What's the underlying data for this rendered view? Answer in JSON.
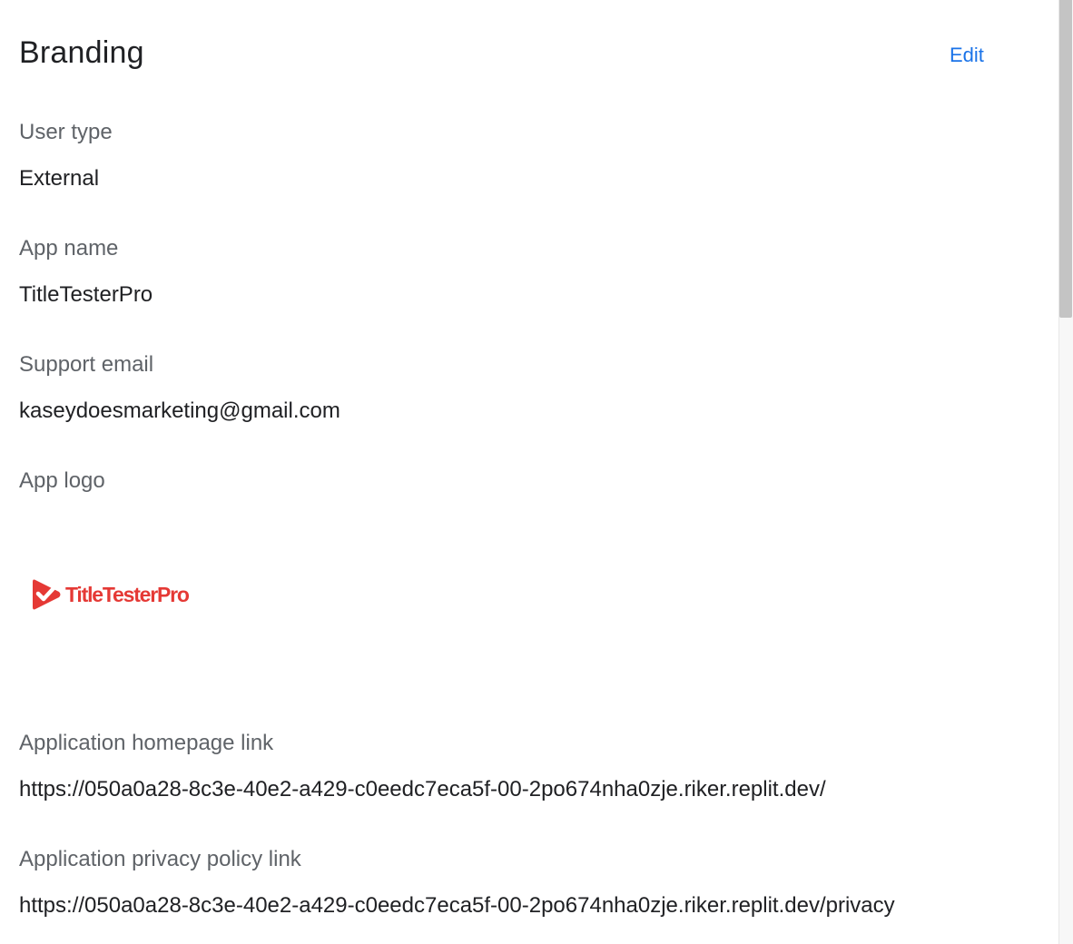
{
  "header": {
    "title": "Branding",
    "edit_label": "Edit"
  },
  "fields": {
    "user_type": {
      "label": "User type",
      "value": "External"
    },
    "app_name": {
      "label": "App name",
      "value": "TitleTesterPro"
    },
    "support_email": {
      "label": "Support email",
      "value": "kaseydoesmarketing@gmail.com"
    },
    "app_logo": {
      "label": "App logo",
      "logo_text": "TitleTesterPro"
    },
    "homepage_link": {
      "label": "Application homepage link",
      "value": "https://050a0a28-8c3e-40e2-a429-c0eedc7eca5f-00-2po674nha0zje.riker.replit.dev/"
    },
    "privacy_link": {
      "label": "Application privacy policy link",
      "value": "https://050a0a28-8c3e-40e2-a429-c0eedc7eca5f-00-2po674nha0zje.riker.replit.dev/privacy"
    }
  },
  "colors": {
    "accent": "#1a73e8",
    "logo_red": "#e53935",
    "label_gray": "#5f6368",
    "text": "#202124"
  },
  "icons": {
    "logo_mark": "red-play-check-icon"
  }
}
